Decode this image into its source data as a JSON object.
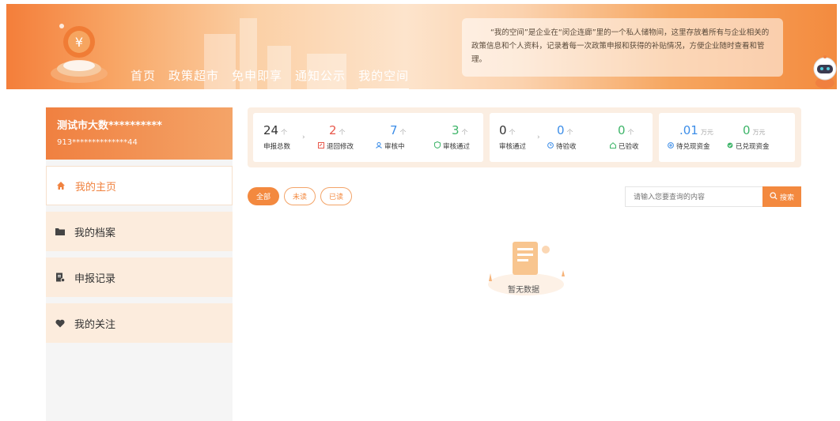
{
  "header": {
    "nav": [
      {
        "label": "首页"
      },
      {
        "label": "政策超市"
      },
      {
        "label": "免申即享"
      },
      {
        "label": "通知公示"
      },
      {
        "label": "我的空间",
        "active": true
      }
    ],
    "intro": "“我的空间”是企业在“闵企连廊”里的一个私人储物间，这里存放着所有与企业相关的政策信息和个人资料，记录着每一次政策申报和获得的补贴情况，方便企业随时查看和管理。"
  },
  "user": {
    "name": "测试市大数**********",
    "code": "913**************44"
  },
  "sidebar": {
    "items": [
      {
        "label": "我的主页",
        "icon": "home-icon",
        "active": true
      },
      {
        "label": "我的档案",
        "icon": "folder-icon"
      },
      {
        "label": "申报记录",
        "icon": "record-icon"
      },
      {
        "label": "我的关注",
        "icon": "heart-icon"
      }
    ]
  },
  "stats": {
    "total": {
      "num": "24",
      "unit": "个",
      "label": "申报总数"
    },
    "returned": {
      "num": "2",
      "unit": "个",
      "label": "退回修改",
      "icon": "edit-icon"
    },
    "reviewing": {
      "num": "7",
      "unit": "个",
      "label": "审核中",
      "icon": "user-icon"
    },
    "approved": {
      "num": "3",
      "unit": "个",
      "label": "审核通过",
      "icon": "shield-icon"
    },
    "passed": {
      "num": "0",
      "unit": "个",
      "label": "审核通过"
    },
    "to_accept": {
      "num": "0",
      "unit": "个",
      "label": "待验收",
      "icon": "clock-icon"
    },
    "accepted": {
      "num": "0",
      "unit": "个",
      "label": "已验收",
      "icon": "house-icon"
    },
    "to_cash": {
      "num": ".01",
      "unit": "万元",
      "label": "待兑现资金",
      "icon": "plus-circle-icon"
    },
    "cashed": {
      "num": "0",
      "unit": "万元",
      "label": "已兑现资金",
      "icon": "check-circle-icon"
    }
  },
  "filters": {
    "all": "全部",
    "unread": "未读",
    "read": "已读"
  },
  "search": {
    "placeholder": "请输入您要查询的内容",
    "button": "搜索"
  },
  "empty": {
    "text": "暂无数据"
  },
  "colors": {
    "accent": "#f3893f",
    "red": "#e8584b",
    "blue": "#3d8ee8",
    "green": "#3fb56a"
  }
}
